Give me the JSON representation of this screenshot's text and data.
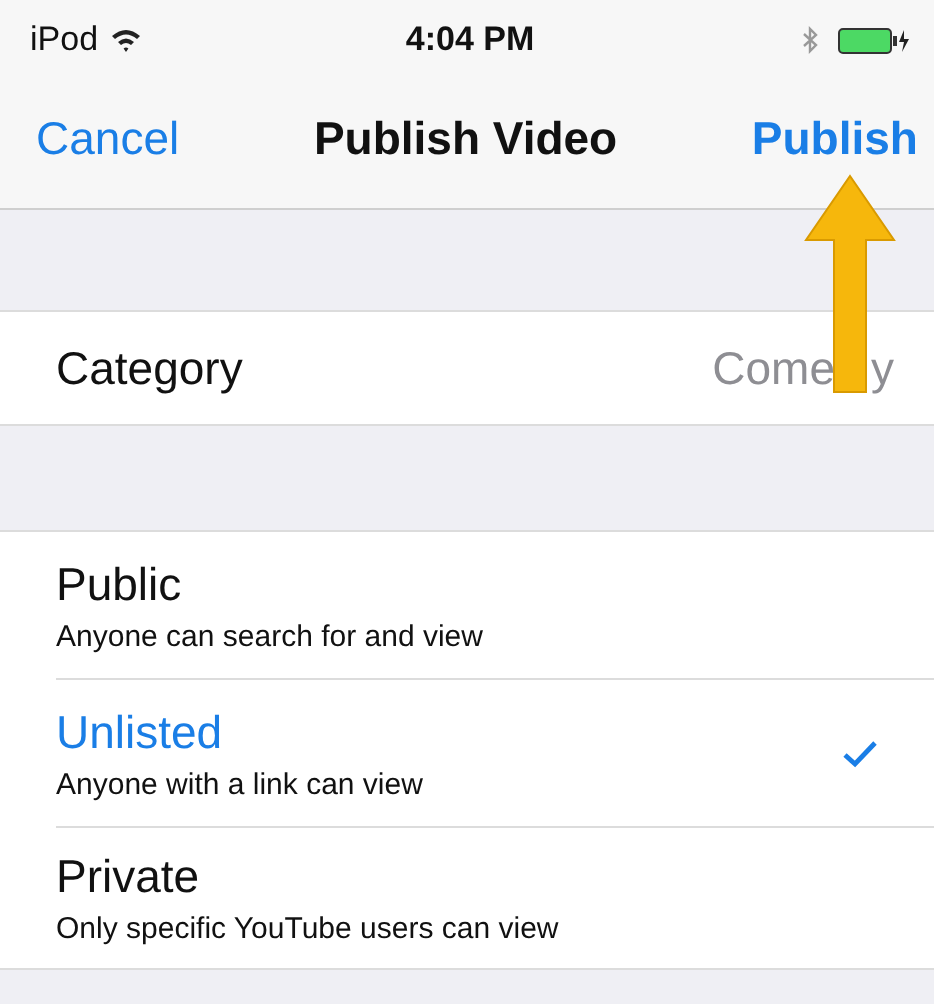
{
  "status_bar": {
    "carrier": "iPod",
    "time": "4:04 PM"
  },
  "nav_bar": {
    "left": "Cancel",
    "title": "Publish Video",
    "right": "Publish"
  },
  "category": {
    "label": "Category",
    "value_parts": [
      "Come",
      "y"
    ]
  },
  "privacy_options": [
    {
      "title": "Public",
      "subtitle": "Anyone can search for and view",
      "selected": false
    },
    {
      "title": "Unlisted",
      "subtitle": "Anyone with a link can view",
      "selected": true
    },
    {
      "title": "Private",
      "subtitle": "Only specific YouTube users can view",
      "selected": false
    }
  ]
}
